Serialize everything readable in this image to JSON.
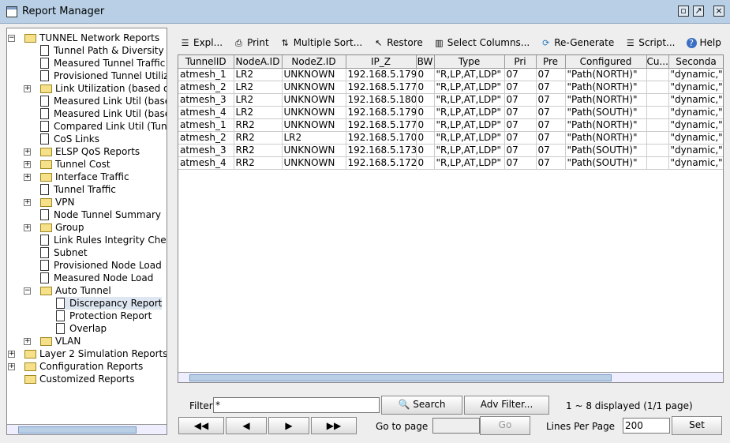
{
  "window": {
    "title": "Report Manager"
  },
  "tree": [
    {
      "label": "TUNNEL Network Reports",
      "level": 0,
      "type": "folder",
      "exp": "-"
    },
    {
      "label": "Tunnel Path & Diversity",
      "level": 1,
      "type": "doc"
    },
    {
      "label": "Measured Tunnel Traffic",
      "level": 1,
      "type": "doc"
    },
    {
      "label": "Provisioned Tunnel Utiliza",
      "level": 1,
      "type": "doc"
    },
    {
      "label": "Link Utilization (based on",
      "level": 1,
      "type": "folder",
      "exp": "+"
    },
    {
      "label": "Measured Link Util (based",
      "level": 1,
      "type": "doc"
    },
    {
      "label": "Measured Link Util (based",
      "level": 1,
      "type": "doc"
    },
    {
      "label": "Compared Link Util (Tunn",
      "level": 1,
      "type": "doc"
    },
    {
      "label": "CoS Links",
      "level": 1,
      "type": "doc"
    },
    {
      "label": "ELSP QoS Reports",
      "level": 1,
      "type": "folder",
      "exp": "+"
    },
    {
      "label": "Tunnel Cost",
      "level": 1,
      "type": "folder",
      "exp": "+"
    },
    {
      "label": "Interface Traffic",
      "level": 1,
      "type": "folder",
      "exp": "+"
    },
    {
      "label": "Tunnel Traffic",
      "level": 1,
      "type": "doc"
    },
    {
      "label": "VPN",
      "level": 1,
      "type": "folder",
      "exp": "+"
    },
    {
      "label": "Node Tunnel Summary",
      "level": 1,
      "type": "doc"
    },
    {
      "label": "Group",
      "level": 1,
      "type": "folder",
      "exp": "+"
    },
    {
      "label": "Link Rules Integrity Check",
      "level": 1,
      "type": "doc"
    },
    {
      "label": "Subnet",
      "level": 1,
      "type": "doc"
    },
    {
      "label": "Provisioned Node Load",
      "level": 1,
      "type": "doc"
    },
    {
      "label": "Measured Node Load",
      "level": 1,
      "type": "doc"
    },
    {
      "label": "Auto Tunnel",
      "level": 1,
      "type": "folder",
      "exp": "-"
    },
    {
      "label": "Discrepancy Report",
      "level": 2,
      "type": "doc",
      "selected": true
    },
    {
      "label": "Protection Report",
      "level": 2,
      "type": "doc"
    },
    {
      "label": "Overlap",
      "level": 2,
      "type": "doc"
    },
    {
      "label": "VLAN",
      "level": 1,
      "type": "folder",
      "exp": "+"
    },
    {
      "label": "Layer 2 Simulation Reports",
      "level": 0,
      "type": "folder",
      "exp": "+"
    },
    {
      "label": "Configuration Reports",
      "level": 0,
      "type": "folder",
      "exp": "+"
    },
    {
      "label": "Customized Reports",
      "level": 0,
      "type": "folder"
    }
  ],
  "toolbar": [
    {
      "label": "Expl...",
      "icon": "document-icon"
    },
    {
      "label": "Print",
      "icon": "printer-icon"
    },
    {
      "label": "Multiple Sort...",
      "icon": "sort-icon"
    },
    {
      "label": "Restore",
      "icon": "restore-icon"
    },
    {
      "label": "Select Columns...",
      "icon": "columns-icon"
    },
    {
      "label": "Re-Generate",
      "icon": "refresh-icon"
    },
    {
      "label": "Script...",
      "icon": "script-icon"
    },
    {
      "label": "Help",
      "icon": "help-icon"
    }
  ],
  "table": {
    "columns": [
      "TunnelID",
      "NodeA.ID",
      "NodeZ.ID",
      "IP_Z",
      "BW",
      "Type",
      "Pri",
      "Pre",
      "Configured",
      "Cu...",
      "Seconda"
    ],
    "rows": [
      [
        "atmesh_1",
        "LR2",
        "UNKNOWN",
        "192.168.5.179",
        "0",
        "\"R,LP,AT,LDP\"",
        "07",
        "07",
        "\"Path(NORTH)\"",
        "",
        "\"dynamic,\""
      ],
      [
        "atmesh_2",
        "LR2",
        "UNKNOWN",
        "192.168.5.177",
        "0",
        "\"R,LP,AT,LDP\"",
        "07",
        "07",
        "\"Path(NORTH)\"",
        "",
        "\"dynamic,\""
      ],
      [
        "atmesh_3",
        "LR2",
        "UNKNOWN",
        "192.168.5.180",
        "0",
        "\"R,LP,AT,LDP\"",
        "07",
        "07",
        "\"Path(NORTH)\"",
        "",
        "\"dynamic,\""
      ],
      [
        "atmesh_4",
        "LR2",
        "UNKNOWN",
        "192.168.5.179",
        "0",
        "\"R,LP,AT,LDP\"",
        "07",
        "07",
        "\"Path(SOUTH)\"",
        "",
        "\"dynamic,\""
      ],
      [
        "atmesh_1",
        "RR2",
        "UNKNOWN",
        "192.168.5.177",
        "0",
        "\"R,LP,AT,LDP\"",
        "07",
        "07",
        "\"Path(NORTH)\"",
        "",
        "\"dynamic,\""
      ],
      [
        "atmesh_2",
        "RR2",
        "LR2",
        "192.168.5.170",
        "0",
        "\"R,LP,AT,LDP\"",
        "07",
        "07",
        "\"Path(NORTH)\"",
        "",
        "\"dynamic,\""
      ],
      [
        "atmesh_3",
        "RR2",
        "UNKNOWN",
        "192.168.5.173",
        "0",
        "\"R,LP,AT,LDP\"",
        "07",
        "07",
        "\"Path(SOUTH)\"",
        "",
        "\"dynamic,\""
      ],
      [
        "atmesh_4",
        "RR2",
        "UNKNOWN",
        "192.168.5.172",
        "0",
        "\"R,LP,AT,LDP\"",
        "07",
        "07",
        "\"Path(SOUTH)\"",
        "",
        "\"dynamic,\""
      ]
    ]
  },
  "footer": {
    "filter_label": "Filter:",
    "filter_value": "*",
    "search": "Search",
    "adv_filter": "Adv Filter...",
    "status": "1 ~ 8 displayed (1/1 page)",
    "goto_label": "Go to page",
    "go": "Go",
    "lines_label": "Lines Per Page",
    "lines_value": "200",
    "set": "Set"
  }
}
